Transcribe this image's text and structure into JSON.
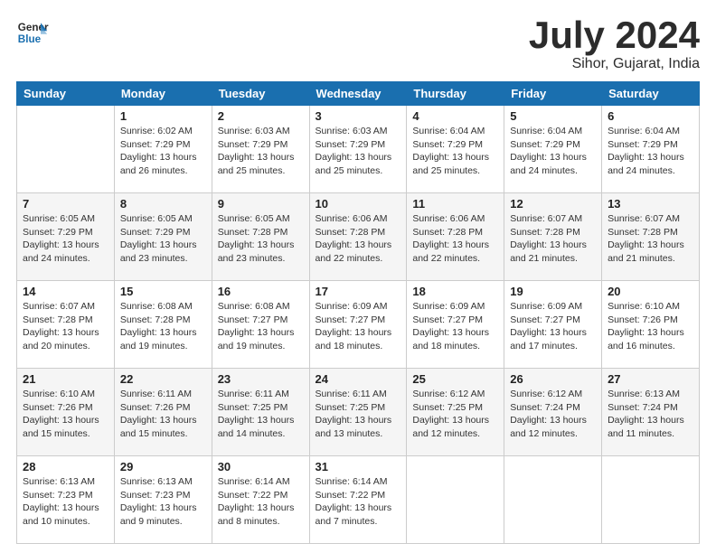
{
  "logo": {
    "line1": "General",
    "line2": "Blue"
  },
  "title": "July 2024",
  "location": "Sihor, Gujarat, India",
  "days": [
    "Sunday",
    "Monday",
    "Tuesday",
    "Wednesday",
    "Thursday",
    "Friday",
    "Saturday"
  ],
  "weeks": [
    [
      {
        "date": "",
        "sunrise": "",
        "sunset": "",
        "daylight": ""
      },
      {
        "date": "1",
        "sunrise": "Sunrise: 6:02 AM",
        "sunset": "Sunset: 7:29 PM",
        "daylight": "Daylight: 13 hours and 26 minutes."
      },
      {
        "date": "2",
        "sunrise": "Sunrise: 6:03 AM",
        "sunset": "Sunset: 7:29 PM",
        "daylight": "Daylight: 13 hours and 25 minutes."
      },
      {
        "date": "3",
        "sunrise": "Sunrise: 6:03 AM",
        "sunset": "Sunset: 7:29 PM",
        "daylight": "Daylight: 13 hours and 25 minutes."
      },
      {
        "date": "4",
        "sunrise": "Sunrise: 6:04 AM",
        "sunset": "Sunset: 7:29 PM",
        "daylight": "Daylight: 13 hours and 25 minutes."
      },
      {
        "date": "5",
        "sunrise": "Sunrise: 6:04 AM",
        "sunset": "Sunset: 7:29 PM",
        "daylight": "Daylight: 13 hours and 24 minutes."
      },
      {
        "date": "6",
        "sunrise": "Sunrise: 6:04 AM",
        "sunset": "Sunset: 7:29 PM",
        "daylight": "Daylight: 13 hours and 24 minutes."
      }
    ],
    [
      {
        "date": "7",
        "sunrise": "Sunrise: 6:05 AM",
        "sunset": "Sunset: 7:29 PM",
        "daylight": "Daylight: 13 hours and 24 minutes."
      },
      {
        "date": "8",
        "sunrise": "Sunrise: 6:05 AM",
        "sunset": "Sunset: 7:29 PM",
        "daylight": "Daylight: 13 hours and 23 minutes."
      },
      {
        "date": "9",
        "sunrise": "Sunrise: 6:05 AM",
        "sunset": "Sunset: 7:28 PM",
        "daylight": "Daylight: 13 hours and 23 minutes."
      },
      {
        "date": "10",
        "sunrise": "Sunrise: 6:06 AM",
        "sunset": "Sunset: 7:28 PM",
        "daylight": "Daylight: 13 hours and 22 minutes."
      },
      {
        "date": "11",
        "sunrise": "Sunrise: 6:06 AM",
        "sunset": "Sunset: 7:28 PM",
        "daylight": "Daylight: 13 hours and 22 minutes."
      },
      {
        "date": "12",
        "sunrise": "Sunrise: 6:07 AM",
        "sunset": "Sunset: 7:28 PM",
        "daylight": "Daylight: 13 hours and 21 minutes."
      },
      {
        "date": "13",
        "sunrise": "Sunrise: 6:07 AM",
        "sunset": "Sunset: 7:28 PM",
        "daylight": "Daylight: 13 hours and 21 minutes."
      }
    ],
    [
      {
        "date": "14",
        "sunrise": "Sunrise: 6:07 AM",
        "sunset": "Sunset: 7:28 PM",
        "daylight": "Daylight: 13 hours and 20 minutes."
      },
      {
        "date": "15",
        "sunrise": "Sunrise: 6:08 AM",
        "sunset": "Sunset: 7:28 PM",
        "daylight": "Daylight: 13 hours and 19 minutes."
      },
      {
        "date": "16",
        "sunrise": "Sunrise: 6:08 AM",
        "sunset": "Sunset: 7:27 PM",
        "daylight": "Daylight: 13 hours and 19 minutes."
      },
      {
        "date": "17",
        "sunrise": "Sunrise: 6:09 AM",
        "sunset": "Sunset: 7:27 PM",
        "daylight": "Daylight: 13 hours and 18 minutes."
      },
      {
        "date": "18",
        "sunrise": "Sunrise: 6:09 AM",
        "sunset": "Sunset: 7:27 PM",
        "daylight": "Daylight: 13 hours and 18 minutes."
      },
      {
        "date": "19",
        "sunrise": "Sunrise: 6:09 AM",
        "sunset": "Sunset: 7:27 PM",
        "daylight": "Daylight: 13 hours and 17 minutes."
      },
      {
        "date": "20",
        "sunrise": "Sunrise: 6:10 AM",
        "sunset": "Sunset: 7:26 PM",
        "daylight": "Daylight: 13 hours and 16 minutes."
      }
    ],
    [
      {
        "date": "21",
        "sunrise": "Sunrise: 6:10 AM",
        "sunset": "Sunset: 7:26 PM",
        "daylight": "Daylight: 13 hours and 15 minutes."
      },
      {
        "date": "22",
        "sunrise": "Sunrise: 6:11 AM",
        "sunset": "Sunset: 7:26 PM",
        "daylight": "Daylight: 13 hours and 15 minutes."
      },
      {
        "date": "23",
        "sunrise": "Sunrise: 6:11 AM",
        "sunset": "Sunset: 7:25 PM",
        "daylight": "Daylight: 13 hours and 14 minutes."
      },
      {
        "date": "24",
        "sunrise": "Sunrise: 6:11 AM",
        "sunset": "Sunset: 7:25 PM",
        "daylight": "Daylight: 13 hours and 13 minutes."
      },
      {
        "date": "25",
        "sunrise": "Sunrise: 6:12 AM",
        "sunset": "Sunset: 7:25 PM",
        "daylight": "Daylight: 13 hours and 12 minutes."
      },
      {
        "date": "26",
        "sunrise": "Sunrise: 6:12 AM",
        "sunset": "Sunset: 7:24 PM",
        "daylight": "Daylight: 13 hours and 12 minutes."
      },
      {
        "date": "27",
        "sunrise": "Sunrise: 6:13 AM",
        "sunset": "Sunset: 7:24 PM",
        "daylight": "Daylight: 13 hours and 11 minutes."
      }
    ],
    [
      {
        "date": "28",
        "sunrise": "Sunrise: 6:13 AM",
        "sunset": "Sunset: 7:23 PM",
        "daylight": "Daylight: 13 hours and 10 minutes."
      },
      {
        "date": "29",
        "sunrise": "Sunrise: 6:13 AM",
        "sunset": "Sunset: 7:23 PM",
        "daylight": "Daylight: 13 hours and 9 minutes."
      },
      {
        "date": "30",
        "sunrise": "Sunrise: 6:14 AM",
        "sunset": "Sunset: 7:22 PM",
        "daylight": "Daylight: 13 hours and 8 minutes."
      },
      {
        "date": "31",
        "sunrise": "Sunrise: 6:14 AM",
        "sunset": "Sunset: 7:22 PM",
        "daylight": "Daylight: 13 hours and 7 minutes."
      },
      {
        "date": "",
        "sunrise": "",
        "sunset": "",
        "daylight": ""
      },
      {
        "date": "",
        "sunrise": "",
        "sunset": "",
        "daylight": ""
      },
      {
        "date": "",
        "sunrise": "",
        "sunset": "",
        "daylight": ""
      }
    ]
  ]
}
